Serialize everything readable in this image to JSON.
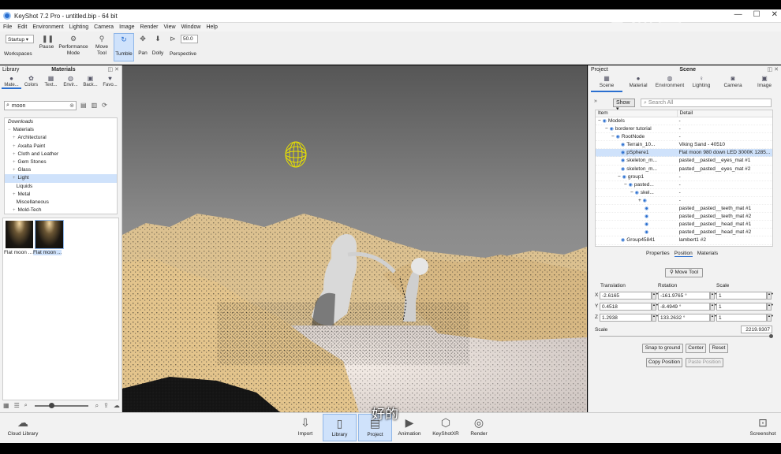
{
  "window": {
    "title": "KeyShot 7.2 Pro  - untitled.bip  - 64 bit",
    "controls": [
      "—",
      "☐",
      "✕"
    ]
  },
  "watermark": "虎课网",
  "subtitle": "好的",
  "menu": [
    "File",
    "Edit",
    "Environment",
    "Lighting",
    "Camera",
    "Image",
    "Render",
    "View",
    "Window",
    "Help"
  ],
  "toolbar": {
    "workspace_select": "Startup",
    "workspaces_label": "Workspaces",
    "pause_label": "Pause",
    "performance_label": "Performance Mode",
    "move_tool_label": "Move Tool",
    "tumble_label": "Tumble",
    "pan_label": "Pan",
    "dolly_label": "Dolly",
    "perspective_label": "Perspective",
    "fov_value": "50.0"
  },
  "library": {
    "title": "Library",
    "center_title": "Materials",
    "tabs": [
      "Mate...",
      "Colors",
      "Text...",
      "Envir...",
      "Back...",
      "Favo..."
    ],
    "search_value": "moon",
    "tree": [
      {
        "label": "Downloads",
        "italic": true
      },
      {
        "label": "Materials",
        "italic": false
      },
      {
        "label": "Architectural"
      },
      {
        "label": "Axalta Paint"
      },
      {
        "label": "Cloth and Leather"
      },
      {
        "label": "Gem Stones"
      },
      {
        "label": "Glass"
      },
      {
        "label": "Light",
        "selected": true
      },
      {
        "label": "Liquids"
      },
      {
        "label": "Metal"
      },
      {
        "label": "Miscellaneous"
      },
      {
        "label": "Mold-Tech"
      }
    ],
    "thumbs": [
      {
        "label": "Flat moon ..."
      },
      {
        "label": "Flat moon ..."
      }
    ]
  },
  "right": {
    "title": "Project",
    "center_title": "Scene",
    "tabs": [
      "Scene",
      "Material",
      "Environment",
      "Lighting",
      "Camera",
      "Image"
    ],
    "show_label": "Show",
    "search_placeholder": "Search All",
    "tree_headers": [
      "Item",
      "Detail"
    ],
    "tree_rows": [
      {
        "item": "Models",
        "detail": "-"
      },
      {
        "item": "borderer tutorial",
        "detail": "-"
      },
      {
        "item": "RootNode",
        "detail": "-"
      },
      {
        "item": "Terrain_10...",
        "detail": "Viking Sand - 40510"
      },
      {
        "item": "pSphere1",
        "detail": "Flat moon 980 down LED 3000K 1285...",
        "selected": true
      },
      {
        "item": "skeleton_m...",
        "detail": "pasted__pasted__eyes_mat #1"
      },
      {
        "item": "skeleton_m...",
        "detail": "pasted__pasted__eyes_mat #2"
      },
      {
        "item": "group1",
        "detail": "-"
      },
      {
        "item": "pasted...",
        "detail": "-"
      },
      {
        "item": "skel...",
        "detail": "-"
      },
      {
        "item": "",
        "detail": "-"
      },
      {
        "item": "",
        "detail": "pasted__pasted__teeth_mat #1"
      },
      {
        "item": "",
        "detail": "pasted__pasted__teeth_mat #2"
      },
      {
        "item": "",
        "detail": "pasted__pasted__head_mat #1"
      },
      {
        "item": "",
        "detail": "pasted__pasted__head_mat #2"
      },
      {
        "item": "Group45841",
        "detail": "lambert1 #2"
      }
    ],
    "subtabs": [
      "Properties",
      "Position",
      "Materials"
    ],
    "move_tool": "Move Tool",
    "col_translation": "Translation",
    "col_rotation": "Rotation",
    "col_scale": "Scale",
    "rows": [
      {
        "axis": "X",
        "t": "-2.6165",
        "r": "-161.9765 °",
        "s": "1"
      },
      {
        "axis": "Y",
        "t": "0.4518",
        "r": "-8.4949 °",
        "s": "1"
      },
      {
        "axis": "Z",
        "t": "1.2938",
        "r": "133.2632 °",
        "s": "1"
      }
    ],
    "scale_label": "Scale",
    "scale_value": "2219.9307",
    "snap_label": "Snap to ground",
    "center_label": "Center",
    "reset_label": "Reset",
    "copy_label": "Copy Position",
    "paste_label": "Paste Position"
  },
  "bottom": {
    "cloud_library": "Cloud Library",
    "import": "Import",
    "library": "Library",
    "project": "Project",
    "animation": "Animation",
    "keyshotxr": "KeyShotXR",
    "render": "Render",
    "screenshot": "Screenshot"
  },
  "colors": {
    "accent": "#2a6fd0",
    "selection": "#cfe2fb",
    "sand": "#e0c08a",
    "light_wire": "#e8e000"
  }
}
